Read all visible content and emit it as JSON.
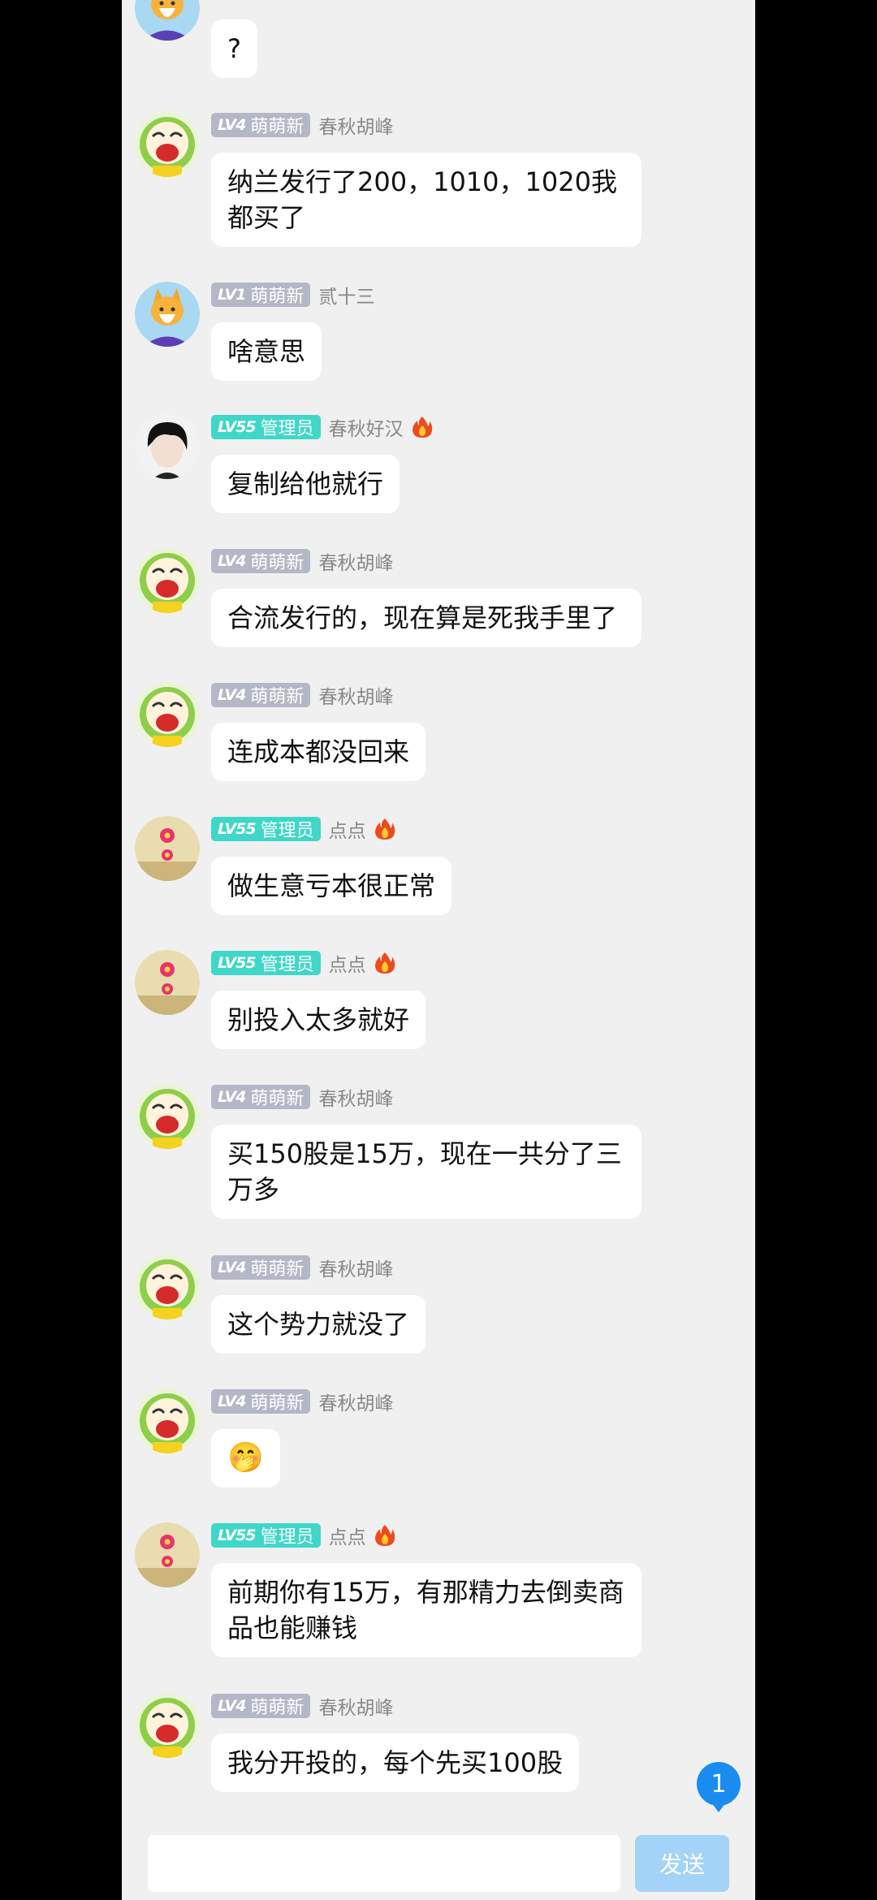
{
  "messages": [
    {
      "avatar": "fox-avatar",
      "text": "?"
    },
    {
      "avatar": "cartoon-avatar",
      "level": "LV4",
      "role": "萌萌新",
      "role_type": "newbie",
      "user": "春秋胡峰",
      "text": "纳兰发行了200，1010，1020我都买了"
    },
    {
      "avatar": "fox-avatar",
      "level": "LV1",
      "role": "萌萌新",
      "role_type": "newbie",
      "user": "贰十三",
      "text": "啥意思"
    },
    {
      "avatar": "boy-avatar",
      "level": "LV55",
      "role": "管理员",
      "role_type": "admin",
      "user": "春秋好汉",
      "fire": true,
      "text": "复制给他就行"
    },
    {
      "avatar": "cartoon-avatar",
      "level": "LV4",
      "role": "萌萌新",
      "role_type": "newbie",
      "user": "春秋胡峰",
      "text": "合流发行的，现在算是死我手里了"
    },
    {
      "avatar": "cartoon-avatar",
      "level": "LV4",
      "role": "萌萌新",
      "role_type": "newbie",
      "user": "春秋胡峰",
      "text": "连成本都没回来"
    },
    {
      "avatar": "flower-avatar",
      "level": "LV55",
      "role": "管理员",
      "role_type": "admin",
      "user": "点点",
      "fire": true,
      "text": "做生意亏本很正常"
    },
    {
      "avatar": "flower-avatar",
      "level": "LV55",
      "role": "管理员",
      "role_type": "admin",
      "user": "点点",
      "fire": true,
      "text": "别投入太多就好"
    },
    {
      "avatar": "cartoon-avatar",
      "level": "LV4",
      "role": "萌萌新",
      "role_type": "newbie",
      "user": "春秋胡峰",
      "text": "买150股是15万，现在一共分了三万多"
    },
    {
      "avatar": "cartoon-avatar",
      "level": "LV4",
      "role": "萌萌新",
      "role_type": "newbie",
      "user": "春秋胡峰",
      "text": "这个势力就没了"
    },
    {
      "avatar": "cartoon-avatar",
      "level": "LV4",
      "role": "萌萌新",
      "role_type": "newbie",
      "user": "春秋胡峰",
      "text": "🤭"
    },
    {
      "avatar": "flower-avatar",
      "level": "LV55",
      "role": "管理员",
      "role_type": "admin",
      "user": "点点",
      "fire": true,
      "text": "前期你有15万，有那精力去倒卖商品也能赚钱"
    },
    {
      "avatar": "cartoon-avatar",
      "level": "LV4",
      "role": "萌萌新",
      "role_type": "newbie",
      "user": "春秋胡峰",
      "text": "我分开投的，每个先买100股"
    }
  ],
  "composer": {
    "input_value": "",
    "send_label": "发送"
  },
  "unread_count": "1",
  "colors": {
    "admin_badge": "#3fd7c8",
    "newbie_badge": "#b3b7c6",
    "send_button": "#a3d3f7",
    "unread_bubble": "#1a8cf0"
  }
}
